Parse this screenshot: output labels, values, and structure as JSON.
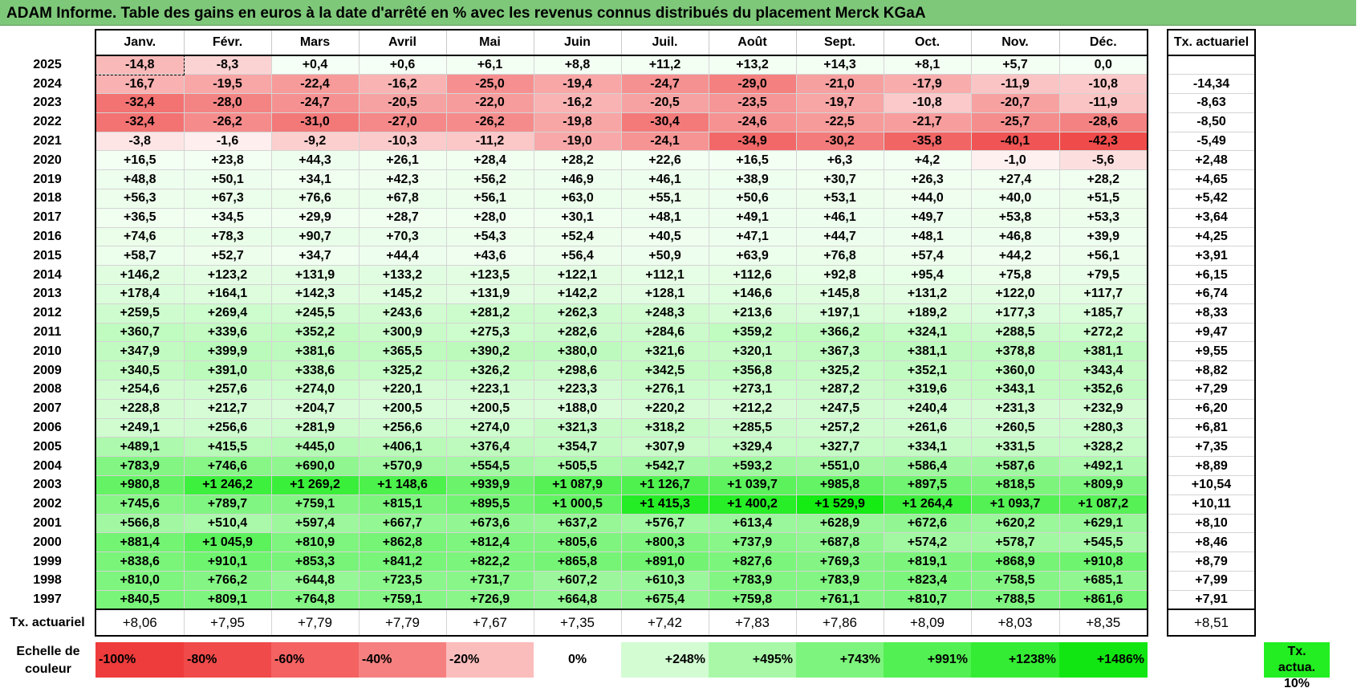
{
  "title": "ADAM Informe. Table des gains en euros à la date d'arrêté en % avec les revenus connus distribués du placement Merck KGaA",
  "months": [
    "Janv.",
    "Févr.",
    "Mars",
    "Avril",
    "Mai",
    "Juin",
    "Juil.",
    "Août",
    "Sept.",
    "Oct.",
    "Nov.",
    "Déc."
  ],
  "rate_header": "Tx. actuariel",
  "rows": [
    {
      "year": "2025",
      "values": [
        "-14,8",
        "-8,3",
        "+0,4",
        "+0,6",
        "+6,1",
        "+8,8",
        "+11,2",
        "+13,2",
        "+14,3",
        "+8,1",
        "+5,7",
        "0,0"
      ],
      "rate": ""
    },
    {
      "year": "2024",
      "values": [
        "-16,7",
        "-19,5",
        "-22,4",
        "-16,2",
        "-25,0",
        "-19,4",
        "-24,7",
        "-29,0",
        "-21,0",
        "-17,9",
        "-11,9",
        "-10,8"
      ],
      "rate": "-14,34"
    },
    {
      "year": "2023",
      "values": [
        "-32,4",
        "-28,0",
        "-24,7",
        "-20,5",
        "-22,0",
        "-16,2",
        "-20,5",
        "-23,5",
        "-19,7",
        "-10,8",
        "-20,7",
        "-11,9"
      ],
      "rate": "-8,63"
    },
    {
      "year": "2022",
      "values": [
        "-32,4",
        "-26,2",
        "-31,0",
        "-27,0",
        "-26,2",
        "-19,8",
        "-30,4",
        "-24,6",
        "-22,5",
        "-21,7",
        "-25,7",
        "-28,6"
      ],
      "rate": "-8,50"
    },
    {
      "year": "2021",
      "values": [
        "-3,8",
        "-1,6",
        "-9,2",
        "-10,3",
        "-11,2",
        "-19,0",
        "-24,1",
        "-34,9",
        "-30,2",
        "-35,8",
        "-40,1",
        "-42,3"
      ],
      "rate": "-5,49"
    },
    {
      "year": "2020",
      "values": [
        "+16,5",
        "+23,8",
        "+44,3",
        "+26,1",
        "+28,4",
        "+28,2",
        "+22,6",
        "+16,5",
        "+6,3",
        "+4,2",
        "-1,0",
        "-5,6"
      ],
      "rate": "+2,48"
    },
    {
      "year": "2019",
      "values": [
        "+48,8",
        "+50,1",
        "+34,1",
        "+42,3",
        "+56,2",
        "+46,9",
        "+46,1",
        "+38,9",
        "+30,7",
        "+26,3",
        "+27,4",
        "+28,2"
      ],
      "rate": "+4,65"
    },
    {
      "year": "2018",
      "values": [
        "+56,3",
        "+67,3",
        "+76,6",
        "+67,8",
        "+56,1",
        "+63,0",
        "+55,1",
        "+50,6",
        "+53,1",
        "+44,0",
        "+40,0",
        "+51,5"
      ],
      "rate": "+5,42"
    },
    {
      "year": "2017",
      "values": [
        "+36,5",
        "+34,5",
        "+29,9",
        "+28,7",
        "+28,0",
        "+30,1",
        "+48,1",
        "+49,1",
        "+46,1",
        "+49,7",
        "+53,8",
        "+53,3"
      ],
      "rate": "+3,64"
    },
    {
      "year": "2016",
      "values": [
        "+74,6",
        "+78,3",
        "+90,7",
        "+70,3",
        "+54,3",
        "+52,4",
        "+40,5",
        "+47,1",
        "+44,7",
        "+48,1",
        "+46,8",
        "+39,9"
      ],
      "rate": "+4,25"
    },
    {
      "year": "2015",
      "values": [
        "+58,7",
        "+52,7",
        "+34,7",
        "+44,4",
        "+43,6",
        "+56,4",
        "+50,9",
        "+63,9",
        "+76,8",
        "+57,4",
        "+44,2",
        "+56,1"
      ],
      "rate": "+3,91"
    },
    {
      "year": "2014",
      "values": [
        "+146,2",
        "+123,2",
        "+131,9",
        "+133,2",
        "+123,5",
        "+122,1",
        "+112,1",
        "+112,6",
        "+92,8",
        "+95,4",
        "+75,8",
        "+79,5"
      ],
      "rate": "+6,15"
    },
    {
      "year": "2013",
      "values": [
        "+178,4",
        "+164,1",
        "+142,3",
        "+145,2",
        "+131,9",
        "+142,2",
        "+128,1",
        "+146,6",
        "+145,8",
        "+131,2",
        "+122,0",
        "+117,7"
      ],
      "rate": "+6,74"
    },
    {
      "year": "2012",
      "values": [
        "+259,5",
        "+269,4",
        "+245,5",
        "+243,6",
        "+281,2",
        "+262,3",
        "+248,3",
        "+213,6",
        "+197,1",
        "+189,2",
        "+177,3",
        "+185,7"
      ],
      "rate": "+8,33"
    },
    {
      "year": "2011",
      "values": [
        "+360,7",
        "+339,6",
        "+352,2",
        "+300,9",
        "+275,3",
        "+282,6",
        "+284,6",
        "+359,2",
        "+366,2",
        "+324,1",
        "+288,5",
        "+272,2"
      ],
      "rate": "+9,47"
    },
    {
      "year": "2010",
      "values": [
        "+347,9",
        "+399,9",
        "+381,6",
        "+365,5",
        "+390,2",
        "+380,0",
        "+321,6",
        "+320,1",
        "+367,3",
        "+381,1",
        "+378,8",
        "+381,1"
      ],
      "rate": "+9,55"
    },
    {
      "year": "2009",
      "values": [
        "+340,5",
        "+391,0",
        "+338,6",
        "+325,2",
        "+326,2",
        "+298,6",
        "+342,5",
        "+356,8",
        "+325,2",
        "+352,1",
        "+360,0",
        "+343,4"
      ],
      "rate": "+8,82"
    },
    {
      "year": "2008",
      "values": [
        "+254,6",
        "+257,6",
        "+274,0",
        "+220,1",
        "+223,1",
        "+223,3",
        "+276,1",
        "+273,1",
        "+287,2",
        "+319,6",
        "+343,1",
        "+352,6"
      ],
      "rate": "+7,29"
    },
    {
      "year": "2007",
      "values": [
        "+228,8",
        "+212,7",
        "+204,7",
        "+200,5",
        "+200,5",
        "+188,0",
        "+220,2",
        "+212,2",
        "+247,5",
        "+240,4",
        "+231,3",
        "+232,9"
      ],
      "rate": "+6,20"
    },
    {
      "year": "2006",
      "values": [
        "+249,1",
        "+256,6",
        "+281,9",
        "+256,6",
        "+274,0",
        "+321,3",
        "+318,2",
        "+285,5",
        "+257,2",
        "+261,6",
        "+260,5",
        "+280,3"
      ],
      "rate": "+6,81"
    },
    {
      "year": "2005",
      "values": [
        "+489,1",
        "+415,5",
        "+445,0",
        "+406,1",
        "+376,4",
        "+354,7",
        "+307,9",
        "+329,4",
        "+327,7",
        "+334,1",
        "+331,5",
        "+328,2"
      ],
      "rate": "+7,35"
    },
    {
      "year": "2004",
      "values": [
        "+783,9",
        "+746,6",
        "+690,0",
        "+570,9",
        "+554,5",
        "+505,5",
        "+542,7",
        "+593,2",
        "+551,0",
        "+586,4",
        "+587,6",
        "+492,1"
      ],
      "rate": "+8,89"
    },
    {
      "year": "2003",
      "values": [
        "+980,8",
        "+1 246,2",
        "+1 269,2",
        "+1 148,6",
        "+939,9",
        "+1 087,9",
        "+1 126,7",
        "+1 039,7",
        "+985,8",
        "+897,5",
        "+818,5",
        "+809,9"
      ],
      "rate": "+10,54"
    },
    {
      "year": "2002",
      "values": [
        "+745,6",
        "+789,7",
        "+759,1",
        "+815,1",
        "+895,5",
        "+1 000,5",
        "+1 415,3",
        "+1 400,2",
        "+1 529,9",
        "+1 264,4",
        "+1 093,7",
        "+1 087,2"
      ],
      "rate": "+10,11"
    },
    {
      "year": "2001",
      "values": [
        "+566,8",
        "+510,4",
        "+597,4",
        "+667,7",
        "+673,6",
        "+637,2",
        "+576,7",
        "+613,4",
        "+628,9",
        "+672,6",
        "+620,2",
        "+629,1"
      ],
      "rate": "+8,10"
    },
    {
      "year": "2000",
      "values": [
        "+881,4",
        "+1 045,9",
        "+810,9",
        "+862,8",
        "+812,4",
        "+805,6",
        "+800,3",
        "+737,9",
        "+687,8",
        "+574,2",
        "+578,7",
        "+545,5"
      ],
      "rate": "+8,46"
    },
    {
      "year": "1999",
      "values": [
        "+838,6",
        "+910,1",
        "+853,3",
        "+841,2",
        "+822,2",
        "+865,8",
        "+891,0",
        "+827,6",
        "+769,3",
        "+819,1",
        "+868,9",
        "+910,8"
      ],
      "rate": "+8,79"
    },
    {
      "year": "1998",
      "values": [
        "+810,0",
        "+766,2",
        "+644,8",
        "+723,5",
        "+731,7",
        "+607,2",
        "+610,3",
        "+783,9",
        "+783,9",
        "+823,4",
        "+758,5",
        "+685,1"
      ],
      "rate": "+7,99"
    },
    {
      "year": "1997",
      "values": [
        "+840,5",
        "+809,1",
        "+764,8",
        "+759,1",
        "+726,9",
        "+664,8",
        "+675,4",
        "+759,8",
        "+761,1",
        "+810,7",
        "+788,5",
        "+861,6"
      ],
      "rate": "+7,91"
    }
  ],
  "summary": {
    "label": "Tx. actuariel",
    "values": [
      "+8,06",
      "+7,95",
      "+7,79",
      "+7,79",
      "+7,67",
      "+7,35",
      "+7,42",
      "+7,83",
      "+7,86",
      "+8,09",
      "+8,03",
      "+8,35"
    ],
    "rate": "+8,51"
  },
  "scale": {
    "label_line1": "Echelle de",
    "label_line2": "couleur",
    "items": [
      {
        "text": "-100%",
        "color": "#ee3b3b"
      },
      {
        "text": "-80%",
        "color": "#f04a4a"
      },
      {
        "text": "-60%",
        "color": "#f46262"
      },
      {
        "text": "-40%",
        "color": "#f68080"
      },
      {
        "text": "-20%",
        "color": "#fbbcbc"
      },
      {
        "text": "0%",
        "color": "#ffffff"
      },
      {
        "text": "+248%",
        "color": "#d3fcd3"
      },
      {
        "text": "+495%",
        "color": "#a8f8a8"
      },
      {
        "text": "+743%",
        "color": "#7df47d"
      },
      {
        "text": "+991%",
        "color": "#52f052"
      },
      {
        "text": "+1238%",
        "color": "#34ec34"
      },
      {
        "text": "+1486%",
        "color": "#12e612"
      }
    ],
    "rate_line1": "Tx.",
    "rate_line2": "actua. 10%",
    "rate_color": "#22ee22"
  }
}
